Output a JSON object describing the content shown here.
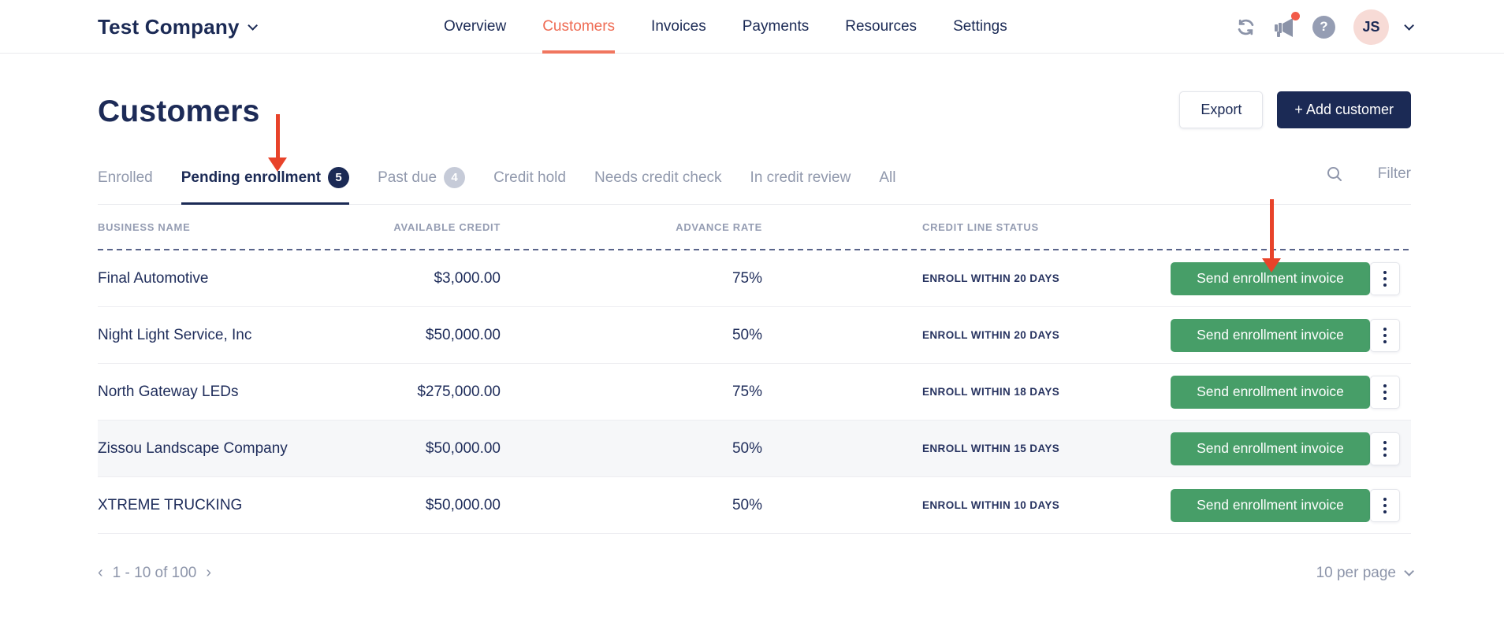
{
  "topnav": {
    "company": "Test Company",
    "items": [
      {
        "label": "Overview"
      },
      {
        "label": "Customers"
      },
      {
        "label": "Invoices"
      },
      {
        "label": "Payments"
      },
      {
        "label": "Resources"
      },
      {
        "label": "Settings"
      }
    ],
    "active_item": "Customers",
    "help_glyph": "?",
    "avatar_initials": "JS"
  },
  "page": {
    "title": "Customers",
    "export_label": "Export",
    "add_customer_label": "+ Add customer"
  },
  "tabs": [
    {
      "label": "Enrolled"
    },
    {
      "label": "Pending enrollment",
      "badge": "5",
      "active": true
    },
    {
      "label": "Past due",
      "badge": "4"
    },
    {
      "label": "Credit hold"
    },
    {
      "label": "Needs credit check"
    },
    {
      "label": "In credit review"
    },
    {
      "label": "All"
    }
  ],
  "toolbar": {
    "filter_label": "Filter"
  },
  "table": {
    "columns": {
      "business_name": "BUSINESS NAME",
      "available_credit": "AVAILABLE CREDIT",
      "advance_rate": "ADVANCE RATE",
      "credit_line_status": "CREDIT LINE STATUS"
    },
    "action_label": "Send enrollment invoice",
    "rows": [
      {
        "business_name": "Final Automotive",
        "available_credit": "$3,000.00",
        "advance_rate": "75%",
        "credit_line_status": "ENROLL WITHIN 20 DAYS"
      },
      {
        "business_name": "Night Light Service, Inc",
        "available_credit": "$50,000.00",
        "advance_rate": "50%",
        "credit_line_status": "ENROLL WITHIN 20 DAYS"
      },
      {
        "business_name": "North Gateway LEDs",
        "available_credit": "$275,000.00",
        "advance_rate": "75%",
        "credit_line_status": "ENROLL WITHIN 18 DAYS"
      },
      {
        "business_name": "Zissou Landscape Company",
        "available_credit": "$50,000.00",
        "advance_rate": "50%",
        "credit_line_status": "ENROLL WITHIN 15 DAYS"
      },
      {
        "business_name": "XTREME TRUCKING",
        "available_credit": "$50,000.00",
        "advance_rate": "50%",
        "credit_line_status": "ENROLL WITHIN 10 DAYS"
      }
    ]
  },
  "pagination": {
    "prev_glyph": "‹",
    "range": "1 - 10 of 100",
    "next_glyph": "›",
    "per_page": "10 per page"
  },
  "colors": {
    "navy": "#1b2a55",
    "coral_active_nav": "#ef6c54",
    "green_action": "#479e68",
    "red_arrow": "#e8432a",
    "muted_text": "#9199ad"
  }
}
